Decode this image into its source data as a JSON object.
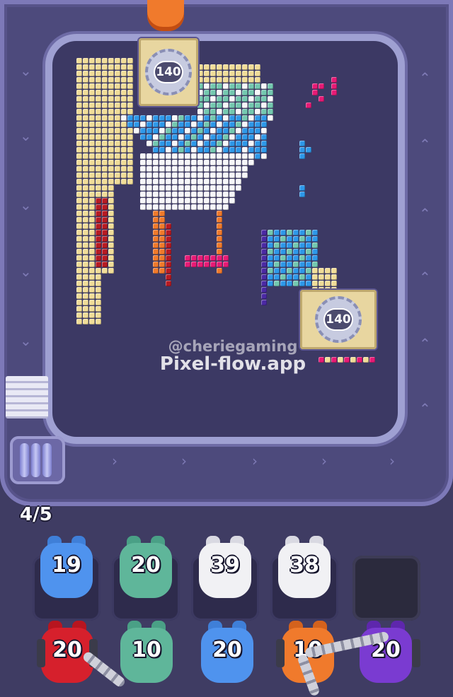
{
  "game": {
    "progress_label": "4/5",
    "watermark_handle": "@cheriegaming",
    "watermark_site": "Pixel-flow.app"
  },
  "board": {
    "gear_cards": [
      {
        "value": "140"
      },
      {
        "value": "140"
      }
    ]
  },
  "queue_row_1": [
    {
      "count": "19",
      "color": "#4f93ee"
    },
    {
      "count": "20",
      "color": "#5fb69a"
    },
    {
      "count": "39",
      "color": "#f1f1f4"
    },
    {
      "count": "38",
      "color": "#f1f1f4"
    },
    {
      "count": "",
      "color": ""
    }
  ],
  "queue_row_2": [
    {
      "count": "20",
      "color": "#d6202c",
      "locked": true
    },
    {
      "count": "10",
      "color": "#5fb69a"
    },
    {
      "count": "20",
      "color": "#4f93ee"
    },
    {
      "count": "10",
      "color": "#f07a2c",
      "locked": true
    },
    {
      "count": "20",
      "color": "#7a3bd1",
      "locked": true
    }
  ],
  "palette": {
    "cream": "#f1dd99",
    "white": "#f7f7fa",
    "teal": "#74c8b0",
    "blue": "#2f98e9",
    "red": "#b71b23",
    "orange": "#f07a2c",
    "pink": "#e61b76",
    "purple": "#4b2aa3"
  }
}
